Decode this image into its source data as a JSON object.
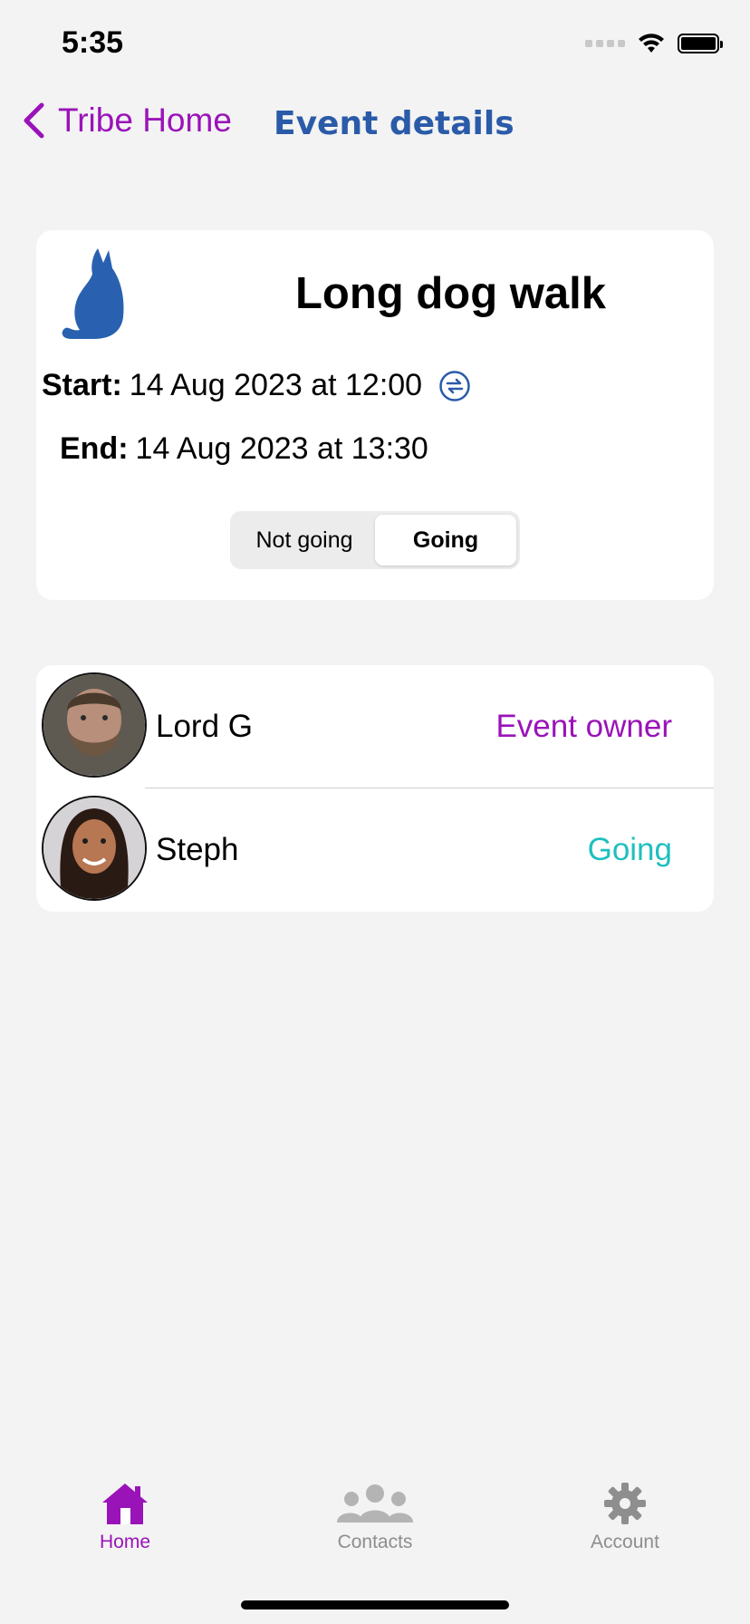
{
  "status_bar": {
    "time": "5:35"
  },
  "nav": {
    "back_label": "Tribe Home",
    "title": "Event details"
  },
  "event": {
    "title": "Long dog walk",
    "start_label": "Start:",
    "start_value": "14 Aug 2023 at 12:00",
    "end_label": "End:",
    "end_value": "14 Aug 2023 at 13:30",
    "rsvp_options": [
      "Not going",
      "Going"
    ],
    "rsvp_selected": "Going"
  },
  "participants": [
    {
      "name": "Lord G",
      "status": "Event owner",
      "status_color": "#9a13b9"
    },
    {
      "name": "Steph",
      "status": "Going",
      "status_color": "#1fbfbf"
    }
  ],
  "tabbar": {
    "items": [
      {
        "label": "Home",
        "icon": "house-icon",
        "active": true
      },
      {
        "label": "Contacts",
        "icon": "people-icon",
        "active": false
      },
      {
        "label": "Account",
        "icon": "gear-icon",
        "active": false
      }
    ]
  },
  "colors": {
    "accent": "#9a13b9",
    "title_blue": "#2a5ba8",
    "going": "#1fbfbf",
    "inactive_tab": "#8e8e8e"
  }
}
